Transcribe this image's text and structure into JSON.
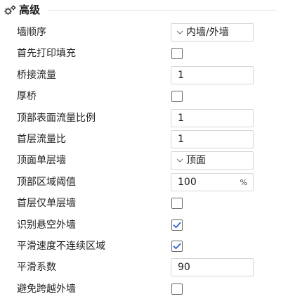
{
  "section": {
    "title": "高级",
    "icon": "gear-cluster-icon"
  },
  "colors": {
    "check": "#2a62d6",
    "border": "#d6d6d6"
  },
  "rows": [
    {
      "label": "墙顺序",
      "type": "select",
      "value": "内墙/外墙"
    },
    {
      "label": "首先打印填充",
      "type": "checkbox",
      "checked": false
    },
    {
      "label": "桥接流量",
      "type": "input",
      "value": "1"
    },
    {
      "label": "厚桥",
      "type": "checkbox",
      "checked": false
    },
    {
      "label": "顶部表面流量比例",
      "type": "input",
      "value": "1"
    },
    {
      "label": "首层流量比",
      "type": "input",
      "value": "1"
    },
    {
      "label": "顶面单层墙",
      "type": "select",
      "value": "顶面"
    },
    {
      "label": "顶部区域阈值",
      "type": "input",
      "value": "100",
      "unit": "%"
    },
    {
      "label": "首层仅单层墙",
      "type": "checkbox",
      "checked": false
    },
    {
      "label": "识别悬空外墙",
      "type": "checkbox",
      "checked": true
    },
    {
      "label": "平滑速度不连续区域",
      "type": "checkbox",
      "checked": true
    },
    {
      "label": "平滑系数",
      "type": "input",
      "value": "90"
    },
    {
      "label": "避免跨越外墙",
      "type": "checkbox",
      "checked": false
    }
  ]
}
